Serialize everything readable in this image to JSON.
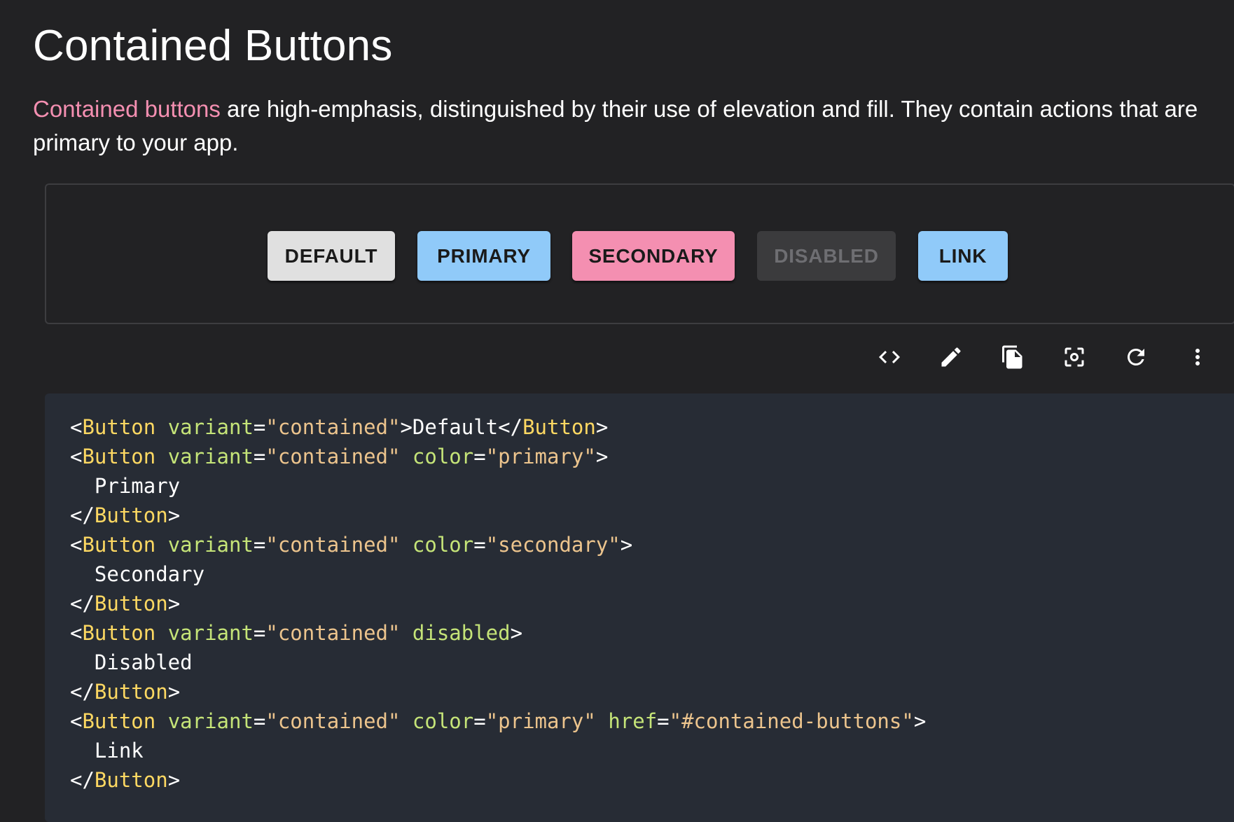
{
  "heading": "Contained Buttons",
  "description": {
    "link_text": "Contained buttons",
    "text": " are high-emphasis, distinguished by their use of elevation and fill. They contain actions that are primary to your app."
  },
  "buttons": {
    "default": "DEFAULT",
    "primary": "PRIMARY",
    "secondary": "SECONDARY",
    "disabled": "DISABLED",
    "link": "LINK"
  },
  "toolbar_icons": [
    "code-icon",
    "edit-icon",
    "copy-icon",
    "screenshot-icon",
    "refresh-icon",
    "more-vert-icon"
  ],
  "colors": {
    "background": "#222224",
    "primary": "#90caf9",
    "secondary": "#f48fb1",
    "default": "#e0e0e0",
    "disabled_bg": "#3b3b3d",
    "code_bg": "#272c35",
    "code_tag": "#fdd862",
    "code_attr": "#c5e478",
    "code_string": "#ecc48d"
  },
  "code": {
    "l1": {
      "b1": "<",
      "tag": "Button",
      "sp": " ",
      "attr": "variant",
      "eq": "=",
      "str": "\"contained\"",
      "b2": ">Default</",
      "tag2": "Button",
      "b3": ">"
    },
    "l2": {
      "b1": "<",
      "tag": "Button",
      "sp": " ",
      "attr": "variant",
      "eq": "=",
      "str": "\"contained\"",
      "sp2": " ",
      "attr2": "color",
      "eq2": "=",
      "str2": "\"primary\"",
      "b2": ">"
    },
    "l3": "  Primary",
    "l4": {
      "b1": "</",
      "tag": "Button",
      "b2": ">"
    },
    "l5": {
      "b1": "<",
      "tag": "Button",
      "sp": " ",
      "attr": "variant",
      "eq": "=",
      "str": "\"contained\"",
      "sp2": " ",
      "attr2": "color",
      "eq2": "=",
      "str2": "\"secondary\"",
      "b2": ">"
    },
    "l6": "  Secondary",
    "l7": {
      "b1": "</",
      "tag": "Button",
      "b2": ">"
    },
    "l8": {
      "b1": "<",
      "tag": "Button",
      "sp": " ",
      "attr": "variant",
      "eq": "=",
      "str": "\"contained\"",
      "sp2": " ",
      "attr2": "disabled",
      "b2": ">"
    },
    "l9": "  Disabled",
    "l10": {
      "b1": "</",
      "tag": "Button",
      "b2": ">"
    },
    "l11": {
      "b1": "<",
      "tag": "Button",
      "sp": " ",
      "attr": "variant",
      "eq": "=",
      "str": "\"contained\"",
      "sp2": " ",
      "attr2": "color",
      "eq2": "=",
      "str2": "\"primary\"",
      "sp3": " ",
      "attr3": "href",
      "eq3": "=",
      "str3": "\"#contained-buttons\"",
      "b2": ">"
    },
    "l12": "  Link",
    "l13": {
      "b1": "</",
      "tag": "Button",
      "b2": ">"
    }
  }
}
